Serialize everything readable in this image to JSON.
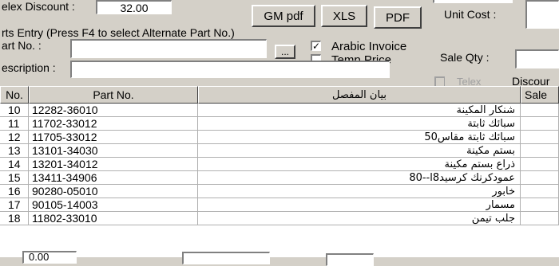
{
  "header": {
    "discount_label": "elex Discount :",
    "discount_value": "32.00",
    "parts_entry_hint": "rts Entry (Press F4 to select Alternate Part No.)",
    "part_no_label": "art No. :",
    "description_label": "escription :",
    "browse_label": "...",
    "unit_cost_label": "Unit Cost :",
    "sale_qty_label": "Sale Qty :",
    "telex_label": "Telex",
    "discount_label2": "Discour"
  },
  "buttons": {
    "gm_pdf": "GM pdf",
    "xls": "XLS",
    "pdf": "PDF"
  },
  "options": {
    "arabic_invoice_label": "Arabic Invoice",
    "arabic_invoice_checked": "✓",
    "temp_price_label": "Temp Price"
  },
  "grid": {
    "columns": [
      "No.",
      "Part No.",
      "بيان المفصل",
      "Sale"
    ],
    "rows": [
      {
        "no": "10",
        "part": "12282-36010",
        "desc": "شنكار المكينة"
      },
      {
        "no": "11",
        "part": "11702-33012",
        "desc": "سبائك ثابتة"
      },
      {
        "no": "12",
        "part": "11705-33012",
        "desc": "سبائك ثابتة مقاس50"
      },
      {
        "no": "13",
        "part": "13101-34030",
        "desc": "بستم مكينة"
      },
      {
        "no": "14",
        "part": "13201-34012",
        "desc": "ذراع بستم مكينة"
      },
      {
        "no": "15",
        "part": "13411-34906",
        "desc": "عمودكرنك كرسيد8ا--80"
      },
      {
        "no": "16",
        "part": "90280-05010",
        "desc": "خابور"
      },
      {
        "no": "17",
        "part": "90105-14003",
        "desc": "مسمار"
      },
      {
        "no": "18",
        "part": "11802-33010",
        "desc": "جلب تيمن"
      }
    ]
  },
  "footer": {
    "partial_value": "0.00"
  }
}
